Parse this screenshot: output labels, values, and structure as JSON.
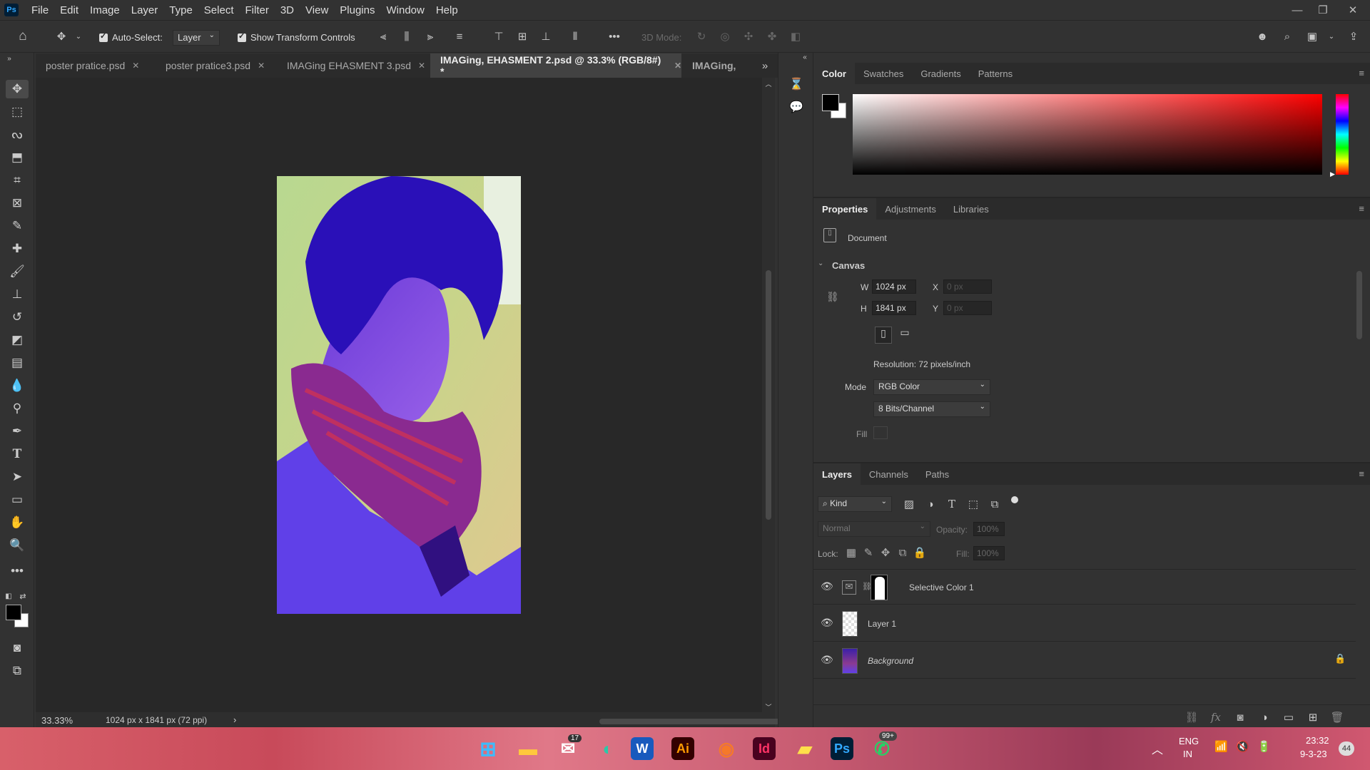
{
  "app": {
    "logo": "Ps"
  },
  "menu": [
    "File",
    "Edit",
    "Image",
    "Layer",
    "Type",
    "Select",
    "Filter",
    "3D",
    "View",
    "Plugins",
    "Window",
    "Help"
  ],
  "window_controls": {
    "minimize": "—",
    "restore": "❐",
    "close": "✕"
  },
  "options": {
    "auto_select_label": "Auto-Select:",
    "auto_select_value": "Layer",
    "transform_label": "Show Transform Controls",
    "more": "•••",
    "mode_3d_label": "3D Mode:"
  },
  "tabs": [
    {
      "label": "poster pratice.psd",
      "close": "✕"
    },
    {
      "label": "poster pratice3.psd",
      "close": "✕"
    },
    {
      "label": "IMAGing EHASMENT 3.psd",
      "close": "✕"
    },
    {
      "label": "IMAGing, EHASMENT 2.psd @ 33.3% (RGB/8#) *",
      "close": "✕"
    },
    {
      "label": "IMAGing,",
      "close": ""
    }
  ],
  "tabs_overflow": "»",
  "status": {
    "zoom": "33.33%",
    "doc_info": "1024 px x 1841 px (72 ppi)",
    "arrow": "›"
  },
  "color_panel": {
    "tabs": [
      "Color",
      "Swatches",
      "Gradients",
      "Patterns"
    ],
    "menu": "≡"
  },
  "properties_panel": {
    "tabs": [
      "Properties",
      "Adjustments",
      "Libraries"
    ],
    "menu": "≡",
    "document_label": "Document",
    "canvas_heading": "Canvas",
    "w_label": "W",
    "w_value": "1024 px",
    "h_label": "H",
    "h_value": "1841 px",
    "x_label": "X",
    "x_value": "0 px",
    "y_label": "Y",
    "y_value": "0 px",
    "resolution": "Resolution: 72 pixels/inch",
    "mode_label": "Mode",
    "mode_value": "RGB Color",
    "bits_value": "8 Bits/Channel",
    "fill_label": "Fill"
  },
  "layers_panel": {
    "tabs": [
      "Layers",
      "Channels",
      "Paths"
    ],
    "menu": "≡",
    "kind_label": "Kind",
    "blend_mode": "Normal",
    "opacity_label": "Opacity:",
    "opacity_value": "100%",
    "lock_label": "Lock:",
    "fill_label": "Fill:",
    "fill_value": "100%",
    "layers": [
      {
        "name": "Selective Color 1",
        "type": "adjustment"
      },
      {
        "name": "Layer 1",
        "type": "transparent"
      },
      {
        "name": "Background",
        "type": "image"
      }
    ]
  },
  "taskbar": {
    "mail_badge": "17",
    "whatsapp_badge": "99+",
    "ai_label": "Ai",
    "id_label": "Id",
    "ps_label": "Ps",
    "w_label": "W",
    "lang_top": "ENG",
    "lang_bottom": "IN",
    "time": "23:32",
    "date": "9-3-23",
    "notif_count": "44"
  },
  "colors": {
    "accent_blue": "#31a8ff",
    "panel_bg": "#323232",
    "canvas_bg": "#282828"
  }
}
